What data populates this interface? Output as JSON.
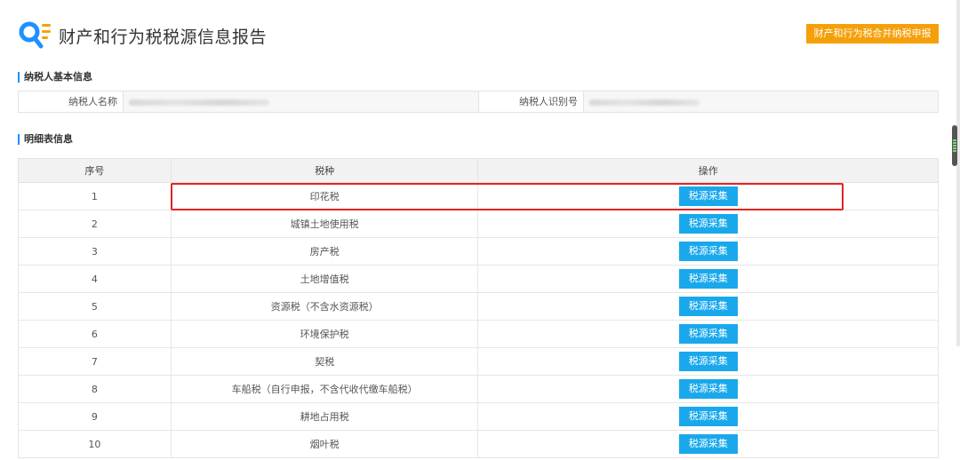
{
  "header": {
    "title": "财产和行为税税源信息报告",
    "submit_label": "财产和行为税合并纳税申报"
  },
  "sections": {
    "basic_info": "纳税人基本信息",
    "detail_info": "明细表信息"
  },
  "taxpayer": {
    "name_label": "纳税人名称",
    "id_label": "纳税人识别号"
  },
  "table": {
    "headers": [
      "序号",
      "税种",
      "操作"
    ],
    "action_label": "税源采集",
    "rows": [
      {
        "no": "1",
        "tax": "印花税"
      },
      {
        "no": "2",
        "tax": "城镇土地使用税"
      },
      {
        "no": "3",
        "tax": "房产税"
      },
      {
        "no": "4",
        "tax": "土地增值税"
      },
      {
        "no": "5",
        "tax": "资源税（不含水资源税）"
      },
      {
        "no": "6",
        "tax": "环境保护税"
      },
      {
        "no": "7",
        "tax": "契税"
      },
      {
        "no": "8",
        "tax": "车船税（自行申报，不含代收代缴车船税）"
      },
      {
        "no": "9",
        "tax": "耕地占用税"
      },
      {
        "no": "10",
        "tax": "烟叶税"
      }
    ]
  },
  "colors": {
    "accent_orange": "#f5a00a",
    "action_blue": "#19a8ec",
    "highlight_red": "#e02424",
    "section_bar": "#1e90ff"
  },
  "icons": {
    "logo": "search-document-icon"
  }
}
